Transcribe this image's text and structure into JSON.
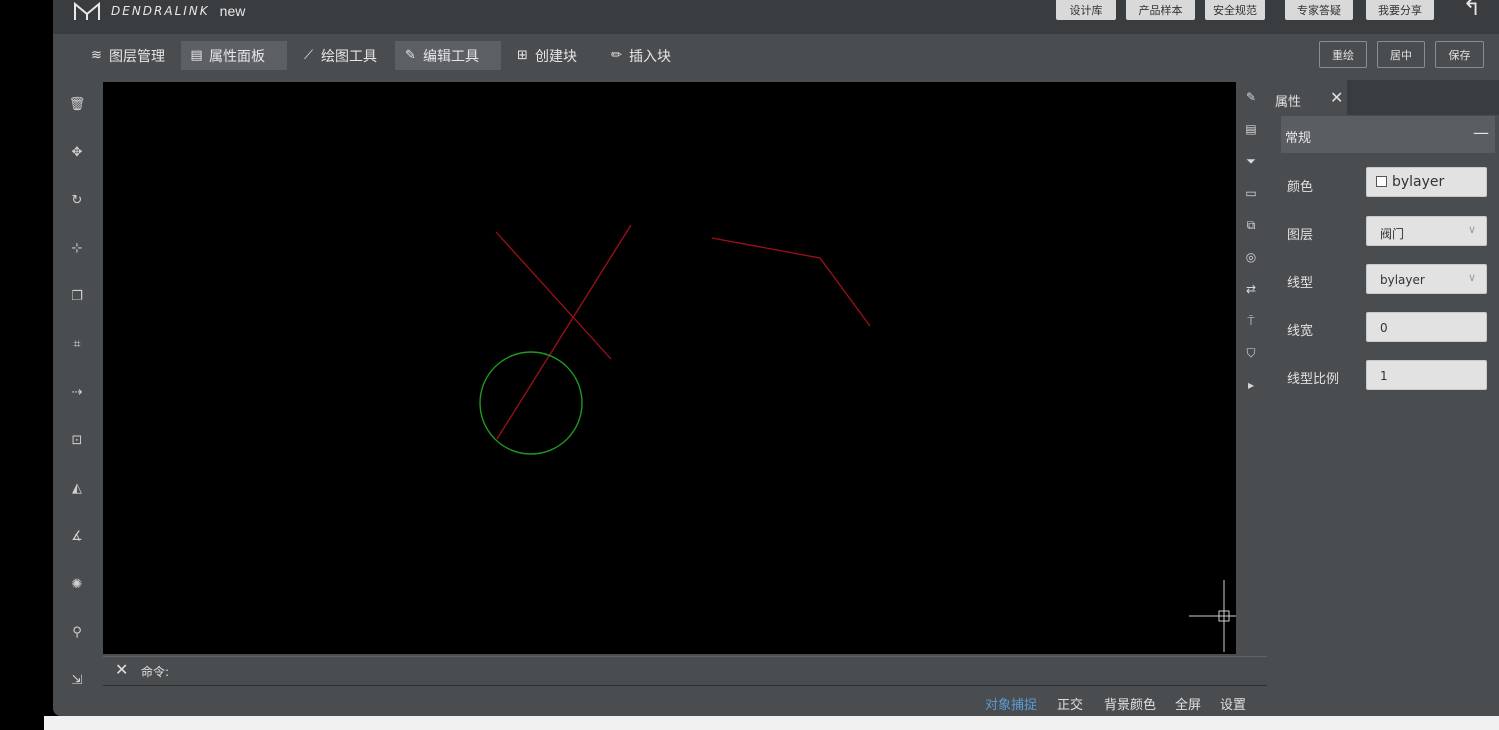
{
  "header": {
    "brand": "DENDRALINK",
    "doc_name": "new",
    "buttons": [
      "设计库",
      "产品样本",
      "安全规范",
      "专家答疑",
      "我要分享"
    ],
    "undo_icon": "undo-arrow-icon"
  },
  "toolbar": {
    "items": [
      {
        "label": "图层管理",
        "icon": "layers-icon"
      },
      {
        "label": "属性面板",
        "icon": "document-icon"
      },
      {
        "label": "绘图工具",
        "icon": "draw-icon"
      },
      {
        "label": "编辑工具",
        "icon": "edit-icon"
      },
      {
        "label": "创建块",
        "icon": "plus-box-icon"
      },
      {
        "label": "插入块",
        "icon": "pencil-icon"
      }
    ],
    "right_buttons": [
      "重绘",
      "居中",
      "保存"
    ]
  },
  "left_tools": [
    "delete-icon",
    "move-icon",
    "rotate-icon",
    "scale-icon",
    "copy-icon",
    "trim-icon",
    "extend-icon",
    "stretch-icon",
    "mirror-icon",
    "angle-icon",
    "explode-icon",
    "search-icon",
    "export-icon"
  ],
  "right_tools": [
    "pencil-icon",
    "paint-roller-icon",
    "filter-icon",
    "pdf-icon",
    "image-icon",
    "snapshot-icon",
    "arrows-icon",
    "brush-icon",
    "bucket-icon",
    "terminal-icon"
  ],
  "command": {
    "label": "命令:"
  },
  "status_bar": {
    "items": [
      {
        "label": "对象捕捉",
        "active": true
      },
      {
        "label": "正交",
        "active": false
      },
      {
        "label": "背景颜色",
        "active": false
      },
      {
        "label": "全屏",
        "active": false
      },
      {
        "label": "设置",
        "active": false
      }
    ],
    "active_color": "#5b9bd5"
  },
  "properties": {
    "tab_label": "属性",
    "section": "常规",
    "rows": [
      {
        "label": "颜色",
        "value": "bylayer",
        "kind": "color"
      },
      {
        "label": "图层",
        "value": "阀门",
        "kind": "select"
      },
      {
        "label": "线型",
        "value": "bylayer",
        "kind": "select"
      },
      {
        "label": "线宽",
        "value": "0",
        "kind": "input"
      },
      {
        "label": "线型比例",
        "value": "1",
        "kind": "input"
      }
    ]
  },
  "drawing": {
    "line_color": "#a0101a",
    "circle_color": "#1e9a1e"
  }
}
